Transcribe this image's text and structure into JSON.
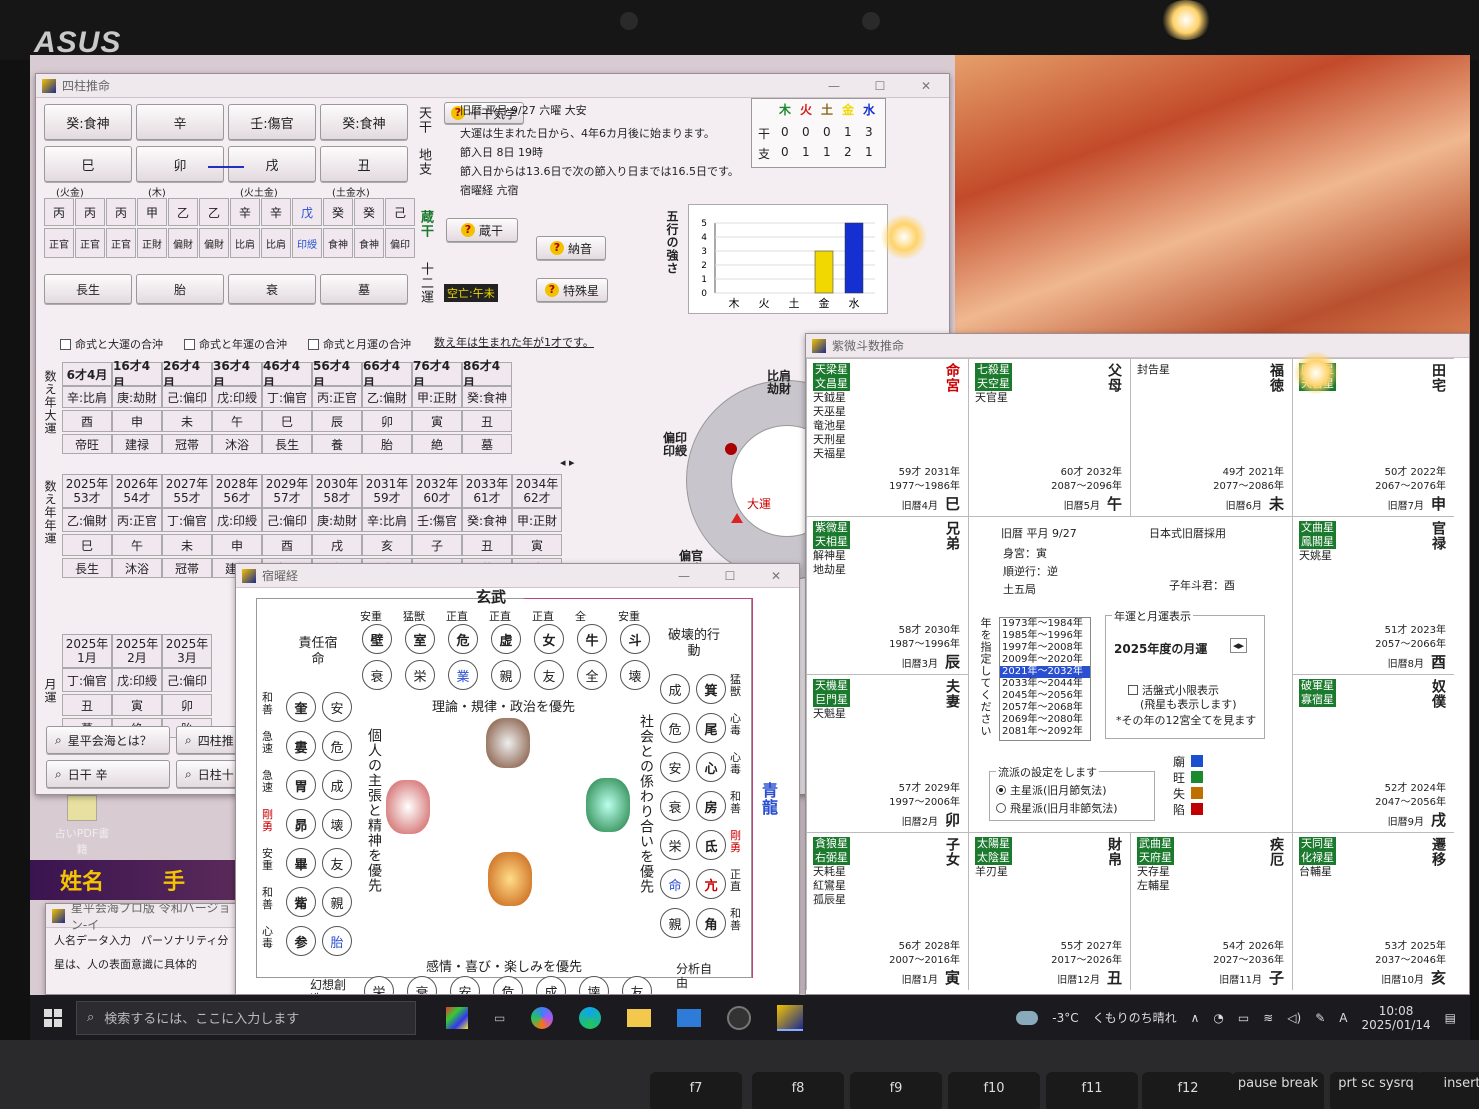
{
  "device": {
    "brand": "ASUS"
  },
  "shichu": {
    "title": "四柱推命",
    "tenkan": [
      "癸:食神",
      "辛",
      "壬:傷官",
      "癸:食神"
    ],
    "tenkan_label": "天干",
    "chishi": [
      "巳",
      "卯",
      "戌",
      "丑"
    ],
    "chishi_label": "地支",
    "gogyo_sub": [
      "(火金)",
      "(木)",
      "(火土金)",
      "(土金水)"
    ],
    "zoukan": [
      "丙",
      "丙",
      "丙",
      "甲",
      "乙",
      "乙",
      "辛",
      "辛",
      "戊",
      "癸",
      "癸",
      "己"
    ],
    "zoukan_label": "蔵干",
    "zoukan_tsuhen": [
      "正官",
      "正官",
      "正官",
      "正財",
      "偏財",
      "偏財",
      "比肩",
      "比肩",
      "印綬",
      "食神",
      "食神",
      "偏印"
    ],
    "unsei": [
      "長生",
      "胎",
      "衰",
      "墓"
    ],
    "unsei_label": "十二運",
    "btn_jikkan": "十干気学",
    "btn_zoukan": "蔵干",
    "btn_nacchin": "納音",
    "btn_tokushu": "特殊星",
    "kuubou": "空亡:午未",
    "info": [
      "旧暦 平月 9/27 六曜 大安",
      "大運は生まれた日から、4年6カ月後に始まります。",
      "節入日 8日 19時",
      "節入日からは13.6日で次の節入り日までは16.5日です。",
      "宿曜経 亢宿"
    ],
    "gg_header": [
      "木",
      "火",
      "土",
      "金",
      "水"
    ],
    "gg_kan_label": "干",
    "gg_shi_label": "支",
    "gg_kan": [
      "0",
      "0",
      "0",
      "1",
      "3"
    ],
    "gg_shi": [
      "0",
      "1",
      "1",
      "2",
      "1"
    ],
    "chk": [
      "命式と大運の合沖",
      "命式と年運の合沖",
      "命式と月運の合沖"
    ],
    "kazoe_note": "数え年は生まれた年が1才です。",
    "daiun_label": "数え年大運",
    "daiun": [
      {
        "age": "6才4月",
        "ts": "辛:比肩",
        "shi": "酉",
        "un": "帝旺"
      },
      {
        "age": "16才4月",
        "ts": "庚:劫財",
        "shi": "申",
        "un": "建禄"
      },
      {
        "age": "26才4月",
        "ts": "己:偏印",
        "shi": "未",
        "un": "冠帯"
      },
      {
        "age": "36才4月",
        "ts": "戊:印綬",
        "shi": "午",
        "un": "沐浴"
      },
      {
        "age": "46才4月",
        "ts": "丁:偏官",
        "shi": "巳",
        "un": "長生"
      },
      {
        "age": "56才4月",
        "ts": "丙:正官",
        "shi": "辰",
        "un": "養"
      },
      {
        "age": "66才4月",
        "ts": "乙:偏財",
        "shi": "卯",
        "un": "胎"
      },
      {
        "age": "76才4月",
        "ts": "甲:正財",
        "shi": "寅",
        "un": "絶"
      },
      {
        "age": "86才4月",
        "ts": "癸:食神",
        "shi": "丑",
        "un": "墓"
      }
    ],
    "nenun_label": "数え年年運",
    "nenun": [
      {
        "y": "2025年",
        "a": "53才",
        "ts": "乙:偏財",
        "shi": "巳",
        "un": "長生"
      },
      {
        "y": "2026年",
        "a": "54才",
        "ts": "丙:正官",
        "shi": "午",
        "un": "沐浴"
      },
      {
        "y": "2027年",
        "a": "55才",
        "ts": "丁:偏官",
        "shi": "未",
        "un": "冠帯"
      },
      {
        "y": "2028年",
        "a": "56才",
        "ts": "戊:印綬",
        "shi": "申",
        "un": "建禄"
      },
      {
        "y": "2029年",
        "a": "57才",
        "ts": "己:偏印",
        "shi": "酉",
        "un": "帝旺"
      },
      {
        "y": "2030年",
        "a": "58才",
        "ts": "庚:劫財",
        "shi": "戌",
        "un": "衰"
      },
      {
        "y": "2031年",
        "a": "59才",
        "ts": "辛:比肩",
        "shi": "亥",
        "un": "病"
      },
      {
        "y": "2032年",
        "a": "60才",
        "ts": "壬:傷官",
        "shi": "子",
        "un": "死"
      },
      {
        "y": "2033年",
        "a": "61才",
        "ts": "癸:食神",
        "shi": "丑",
        "un": "墓"
      },
      {
        "y": "2034年",
        "a": "62才",
        "ts": "甲:正財",
        "shi": "寅",
        "un": "絶"
      }
    ],
    "getsuun_label": "月運",
    "getsuun": [
      {
        "y": "2025年",
        "m": "1月",
        "ts": "丁:偏官",
        "shi": "丑",
        "un": "墓"
      },
      {
        "y": "2025年",
        "m": "2月",
        "ts": "戊:印綬",
        "shi": "寅",
        "un": "絶"
      },
      {
        "y": "2025年",
        "m": "3月",
        "ts": "己:偏印",
        "shi": "卯",
        "un": "胎"
      }
    ],
    "btns": [
      "星平会海とは？",
      "四柱推",
      "日干 辛",
      "日柱十"
    ],
    "wheel": [
      "比肩劫財",
      "偏印印綬",
      "偏官正官",
      "大運"
    ]
  },
  "gogyo_chart": {
    "type": "bar",
    "ylabel": "五行の強さ",
    "categories": [
      "木",
      "火",
      "土",
      "金",
      "水"
    ],
    "values": [
      0,
      0,
      0,
      3,
      5
    ],
    "ylim": [
      0,
      5
    ],
    "yticks": [
      "0",
      "1",
      "2",
      "3",
      "4",
      "5"
    ],
    "colors": [
      "#1e8a2e",
      "#d02020",
      "#8a6a20",
      "#f0d800",
      "#1530d0"
    ]
  },
  "shukuyo": {
    "title": "宿曜経",
    "top_label": "玄武",
    "top_anno": [
      "安重",
      "猛獣",
      "正直",
      "正直",
      "正直",
      "全",
      "安重"
    ],
    "top_row": [
      "壁",
      "室",
      "危",
      "虚",
      "女",
      "牛",
      "斗"
    ],
    "top_row2": [
      "衰",
      "栄",
      "業",
      "親",
      "友",
      "全",
      "壊"
    ],
    "left_head": "責任宿命",
    "left_pairs": [
      [
        "奎",
        "安"
      ],
      [
        "婁",
        "危"
      ],
      [
        "胃",
        "成"
      ],
      [
        "昴",
        "壊"
      ],
      [
        "畢",
        "友"
      ],
      [
        "觜",
        "親"
      ],
      [
        "参",
        "胎"
      ]
    ],
    "left_anno": [
      "和善",
      "急速",
      "急速",
      "剛勇",
      "安重",
      "和善",
      "心毒"
    ],
    "right_head": "破壊的行動",
    "right_pairs": [
      [
        "成",
        "箕"
      ],
      [
        "危",
        "尾"
      ],
      [
        "安",
        "心"
      ],
      [
        "衰",
        "房"
      ],
      [
        "栄",
        "氐"
      ],
      [
        "命",
        "亢"
      ],
      [
        "親",
        "角"
      ]
    ],
    "right_anno": [
      "猛獣",
      "心毒",
      "心毒",
      "和善",
      "剛勇",
      "正直",
      "和善"
    ],
    "center_top": "理論・規律・政治を優先",
    "center_bottom": "感情・喜び・楽しみを優先",
    "left_side": "個人の主張と精神を優先",
    "right_side": "社会との係わり合いを優先",
    "dragon": "青龍",
    "bottom_row": [
      "栄",
      "衰",
      "安",
      "危",
      "成",
      "壊",
      "友"
    ],
    "bottom_left": "幻想創造",
    "bottom_right": "分析自由"
  },
  "shibi": {
    "title": "紫微斗数推命",
    "palaces": [
      {
        "name": "命宮",
        "stars": [
          "天梁星",
          "文昌星",
          "天鉞星",
          "天巫星",
          "竜池星",
          "天刑星",
          "天福星"
        ],
        "age": "59才 2031年",
        "range": "1977～1986年",
        "month": "旧暦4月",
        "branch": "巳"
      },
      {
        "name": "父母",
        "stars": [
          "七殺星",
          "天空星",
          "天官星"
        ],
        "age": "60才 2032年",
        "range": "2087～2096年",
        "month": "旧暦5月",
        "branch": "午"
      },
      {
        "name": "福徳",
        "stars": [
          "封告星"
        ],
        "age": "49才 2021年",
        "range": "2077～2086年",
        "month": "旧暦6月",
        "branch": "未"
      },
      {
        "name": "田宅",
        "stars": [
          "廉貞星",
          "天喜星"
        ],
        "age": "50才 2022年",
        "range": "2067～2076年",
        "month": "旧暦7月",
        "branch": "申"
      },
      {
        "name": "兄弟",
        "stars": [
          "紫微星",
          "天相星",
          "解神星",
          "地劫星"
        ],
        "age": "58才 2030年",
        "range": "1987～1996年",
        "month": "旧暦3月",
        "branch": "辰"
      },
      {
        "name": "官禄",
        "stars": [
          "文曲星",
          "鳳閣星",
          "天姚星"
        ],
        "age": "51才 2023年",
        "range": "2057～2066年",
        "month": "旧暦8月",
        "branch": "酉"
      },
      {
        "name": "夫妻",
        "stars": [
          "天機星",
          "巨門星",
          "天魁星"
        ],
        "age": "57才 2029年",
        "range": "1997～2006年",
        "month": "旧暦2月",
        "branch": "卯"
      },
      {
        "name": "奴僕",
        "stars": [
          "破軍星",
          "寡宿星"
        ],
        "age": "52才 2024年",
        "range": "2047～2056年",
        "month": "旧暦9月",
        "branch": "戌"
      },
      {
        "name": "子女",
        "stars": [
          "貪狼星",
          "右弼星",
          "天耗星",
          "紅鸞星",
          "孤辰星"
        ],
        "age": "56才 2028年",
        "range": "2007～2016年",
        "month": "旧暦1月",
        "branch": "寅"
      },
      {
        "name": "財帛",
        "stars": [
          "太陽星",
          "太陰星",
          "羊刃星"
        ],
        "age": "55才 2027年",
        "range": "2017～2026年",
        "month": "旧暦12月",
        "branch": "丑"
      },
      {
        "name": "疾厄",
        "stars": [
          "武曲星",
          "天府星",
          "天存星",
          "左輔星"
        ],
        "age": "54才 2026年",
        "range": "2027～2036年",
        "month": "旧暦11月",
        "branch": "子"
      },
      {
        "name": "遷移",
        "stars": [
          "天同星",
          "化禄星",
          "台輔星"
        ],
        "age": "53才 2025年",
        "range": "2037～2046年",
        "month": "旧暦10月",
        "branch": "亥"
      }
    ],
    "center": {
      "kyureki": "旧暦 平月 9/27",
      "system": "日本式旧暦採用",
      "shinkyu": "身宮：寅",
      "junkou": "順逆行：逆",
      "kyoku": "土五局",
      "shishi": "子年斗君：酉",
      "years_label": "年を指定してください",
      "years": [
        "1973年～1984年",
        "1985年～1996年",
        "1997年～2008年",
        "2009年～2020年",
        "2021年～2032年",
        "2033年～2044年",
        "2045年～2056年",
        "2057年～2068年",
        "2069年～2080年",
        "2081年～2092年"
      ],
      "years_selected": "2021年～2032年",
      "unsei_group": "年運と月運表示",
      "unsei_value": "2025年度の月運",
      "chk1": "活盤式小限表示",
      "chk1_sub": "(飛星も表示します)",
      "note": "*その年の12宮全てを見ます",
      "ryuha_group": "流派の設定をします",
      "ryuha_opts": [
        "主星派(旧月節気法)",
        "飛星派(旧月非節気法)"
      ],
      "legend": [
        "廟",
        "旺",
        "失",
        "陷"
      ]
    }
  },
  "desktop": {
    "shortcut": "占いPDF書籍",
    "name_banner": "姓名",
    "hand": "手"
  },
  "kaikai": {
    "title": "星平会海プロ版 令和バージョン-イ",
    "tabs": [
      "人名データ入力",
      "パーソナリティ分"
    ],
    "text": "星は、人の表面意識に具体的"
  },
  "taskbar": {
    "search": "検索するには、ここに入力します",
    "weather": "-3°C",
    "weather_text": "くもりのち晴れ",
    "lang": "A",
    "time": "10:08",
    "date": "2025/01/14"
  },
  "keys": [
    "f7",
    "f8",
    "f9",
    "f10",
    "f11",
    "f12",
    "pause break",
    "prt sc sysrq",
    "insert"
  ]
}
